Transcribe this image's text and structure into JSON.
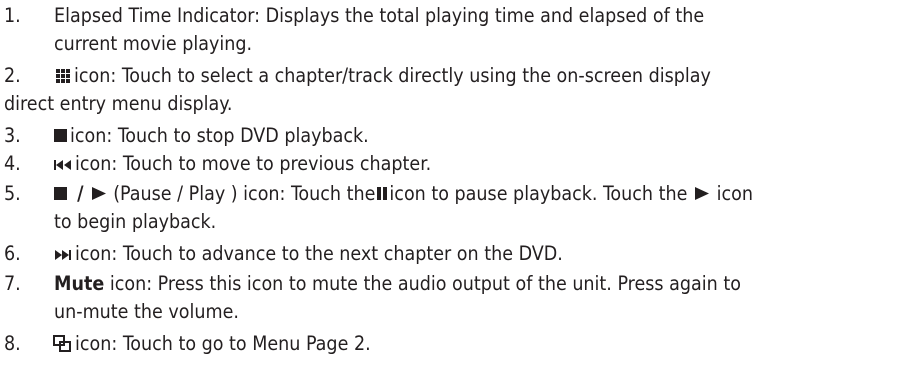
{
  "header_partial": "Elapsed Time Indicator heading (cropped)",
  "items": [
    {
      "number": "1.",
      "lines": [
        "Elapsed Time Indicator: Displays the total playing time and elapsed of the",
        "current movie playing."
      ]
    },
    {
      "number": "2.",
      "icon": "grid-icon",
      "lines": [
        "icon: Touch to select a chapter/track directly using the on-screen  display",
        "direct entry menu display."
      ]
    },
    {
      "number": "3.",
      "icon": "stop-icon",
      "lines": [
        "icon: Touch to stop DVD playback."
      ]
    },
    {
      "number": "4.",
      "icon": "previous-chapter-icon",
      "lines": [
        "icon: Touch to move to previous chapter."
      ]
    },
    {
      "number": "5.",
      "segments": {
        "slash": " / ",
        "paren": "(Pause / Play ) icon: Touch the",
        "mid": "icon to pause playback. Touch the",
        "end": "icon",
        "line2": "to begin playback."
      }
    },
    {
      "number": "6.",
      "icon": "next-chapter-icon",
      "lines": [
        "icon: Touch to advance to the next chapter on the DVD."
      ]
    },
    {
      "number": "7.",
      "bold": "Mute",
      "lines": [
        "icon: Press this icon to mute the audio output of the unit. Press again to",
        "un-mute the volume."
      ]
    },
    {
      "number": "8.",
      "icon": "menu-page-2-icon",
      "lines": [
        "icon: Touch to go to Menu Page 2."
      ]
    }
  ]
}
